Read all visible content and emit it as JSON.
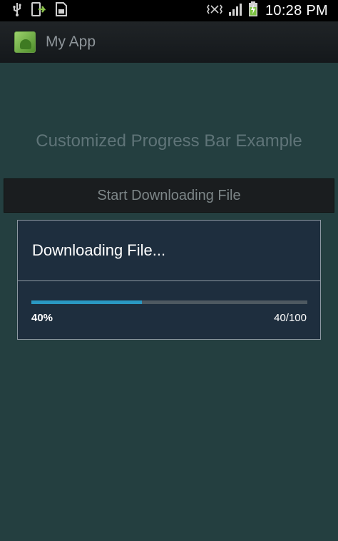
{
  "status_bar": {
    "time": "10:28 PM",
    "icons": [
      "usb-icon",
      "phone-sync-icon",
      "sd-card-icon",
      "signal-icon",
      "battery-charging-icon"
    ]
  },
  "action_bar": {
    "app_title": "My App"
  },
  "main": {
    "heading": "Customized Progress Bar Example",
    "start_button_label": "Start Downloading File"
  },
  "dialog": {
    "title": "Downloading File...",
    "progress": {
      "percent_text": "40%",
      "count_text": "40/100",
      "value": 40,
      "max": 100
    }
  },
  "colors": {
    "background": "#243f40",
    "dialog": "#1e2e3e",
    "progress_fill": "#2a98c2",
    "progress_track": "#4e5961"
  }
}
